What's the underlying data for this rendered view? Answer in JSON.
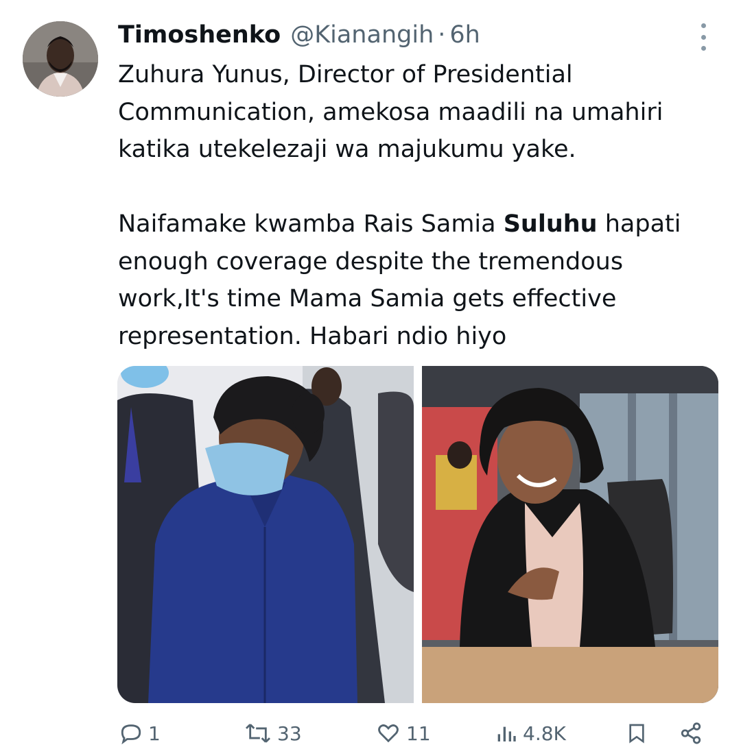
{
  "tweet": {
    "author_name": "Timoshenko",
    "author_handle": "@Kianangih",
    "separator": "·",
    "time": "6h",
    "text": {
      "line1": "Zuhura Yunus, Director of Presidential",
      "line2": "Communication,  amekosa maadili na umahiri",
      "line3": "katika utekelezaji wa majukumu yake.",
      "line4_pre": "Naifamake kwamba Rais Samia ",
      "line4_bold": "Suluhu",
      "line4_post": " hapati",
      "line5": "enough coverage despite the tremendous",
      "line6": "work,It's time Mama Samia gets effective",
      "line7": "representation. Habari ndio hiyo"
    }
  },
  "actions": {
    "replies": "1",
    "retweets": "33",
    "likes": "11",
    "views": "4.8K"
  },
  "colors": {
    "text": "#0f1419",
    "secondary": "#536471"
  }
}
